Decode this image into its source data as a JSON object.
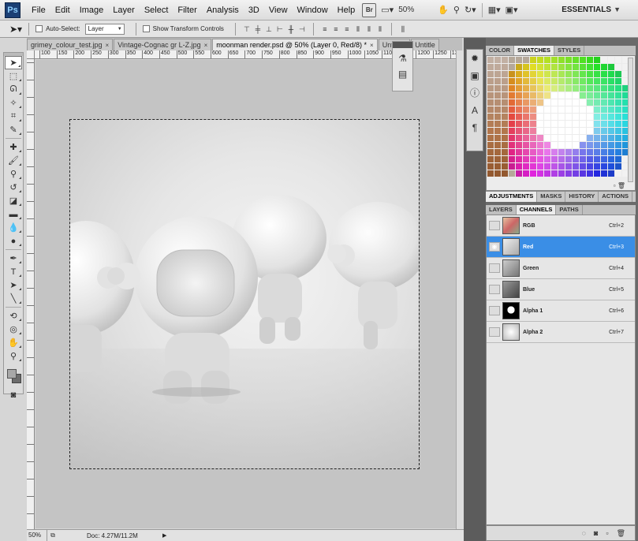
{
  "app": {
    "logo": "Ps"
  },
  "menu": [
    "File",
    "Edit",
    "Image",
    "Layer",
    "Select",
    "Filter",
    "Analysis",
    "3D",
    "View",
    "Window",
    "Help"
  ],
  "menubar_widgets": {
    "bridge_label": "Br",
    "zoom": "50%",
    "workspace": "ESSENTIALS"
  },
  "options": {
    "auto_select_label": "Auto-Select:",
    "auto_select_value": "Layer",
    "show_transform_label": "Show Transform Controls"
  },
  "tabs": [
    {
      "label": "grimey_colour_test.jpg",
      "close": "×"
    },
    {
      "label": "Vintage-Cognac gr L-Z.jpg",
      "close": "×"
    },
    {
      "label": "moonman render.psd @ 50% (Layer 0, Red/8) *",
      "close": "×"
    },
    {
      "label": "Untitled",
      "close": ""
    },
    {
      "label": "Untitle",
      "close": ""
    }
  ],
  "ruler_top": [
    "100",
    "150",
    "200",
    "250",
    "300",
    "350",
    "400",
    "450",
    "500",
    "550",
    "600",
    "650",
    "700",
    "750",
    "800",
    "850",
    "900",
    "950",
    "1000",
    "1050",
    "1100",
    "1150",
    "1200",
    "1250",
    "1300"
  ],
  "status": {
    "zoom": "50%",
    "doc": "Doc: 4.27M/11.2M"
  },
  "panels": {
    "top_tabs": [
      "COLOR",
      "SWATCHES",
      "STYLES"
    ],
    "middle_tabs": [
      "ADJUSTMENTS",
      "MASKS",
      "HISTORY",
      "ACTIONS"
    ],
    "bottom_tabs": [
      "LAYERS",
      "CHANNELS",
      "PATHS"
    ]
  },
  "channels": [
    {
      "name": "RGB",
      "shortcut": "Ctrl+2"
    },
    {
      "name": "Red",
      "shortcut": "Ctrl+3"
    },
    {
      "name": "Green",
      "shortcut": "Ctrl+4"
    },
    {
      "name": "Blue",
      "shortcut": "Ctrl+5"
    },
    {
      "name": "Alpha 1",
      "shortcut": "Ctrl+6"
    },
    {
      "name": "Alpha 2",
      "shortcut": "Ctrl+7"
    }
  ],
  "colors": {
    "selected_row": "#3a8ee6",
    "dock_dark": "#5c5c5c"
  }
}
